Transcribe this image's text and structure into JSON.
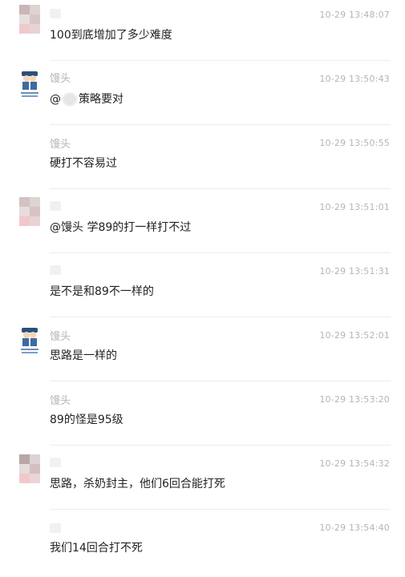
{
  "messages": [
    {
      "sender": "",
      "sender_blurred": true,
      "avatar": "mosaic",
      "time": "10-29 13:48:07",
      "text": "100到底增加了多少难度"
    },
    {
      "sender": "馒头",
      "sender_blurred": false,
      "avatar": "cartoon",
      "time": "10-29 13:50:43",
      "text_prefix": "@",
      "text_suffix": "策略要对"
    },
    {
      "sender": "馒头",
      "sender_blurred": false,
      "avatar": "none",
      "time": "10-29 13:50:55",
      "text": "硬打不容易过"
    },
    {
      "sender": "",
      "sender_blurred": true,
      "avatar": "mosaic",
      "time": "10-29 13:51:01",
      "text": "@馒头 学89的打一样打不过"
    },
    {
      "sender": "",
      "sender_blurred": true,
      "avatar": "none",
      "time": "10-29 13:51:31",
      "text": "是不是和89不一样的"
    },
    {
      "sender": "馒头",
      "sender_blurred": false,
      "avatar": "cartoon",
      "time": "10-29 13:52:01",
      "text": "思路是一样的"
    },
    {
      "sender": "馒头",
      "sender_blurred": false,
      "avatar": "none",
      "time": "10-29 13:53:20",
      "text": "89的怪是95级"
    },
    {
      "sender": "",
      "sender_blurred": true,
      "avatar": "mosaic",
      "time": "10-29 13:54:32",
      "text": "思路，杀奶封主，他们6回合能打死"
    },
    {
      "sender": "",
      "sender_blurred": true,
      "avatar": "none",
      "time": "10-29 13:54:40",
      "text": "我们14回合打不死"
    }
  ],
  "colors": {
    "time": "#b5b5b5",
    "name": "#b3b3b3",
    "text": "#222222",
    "divider": "#ececec"
  }
}
